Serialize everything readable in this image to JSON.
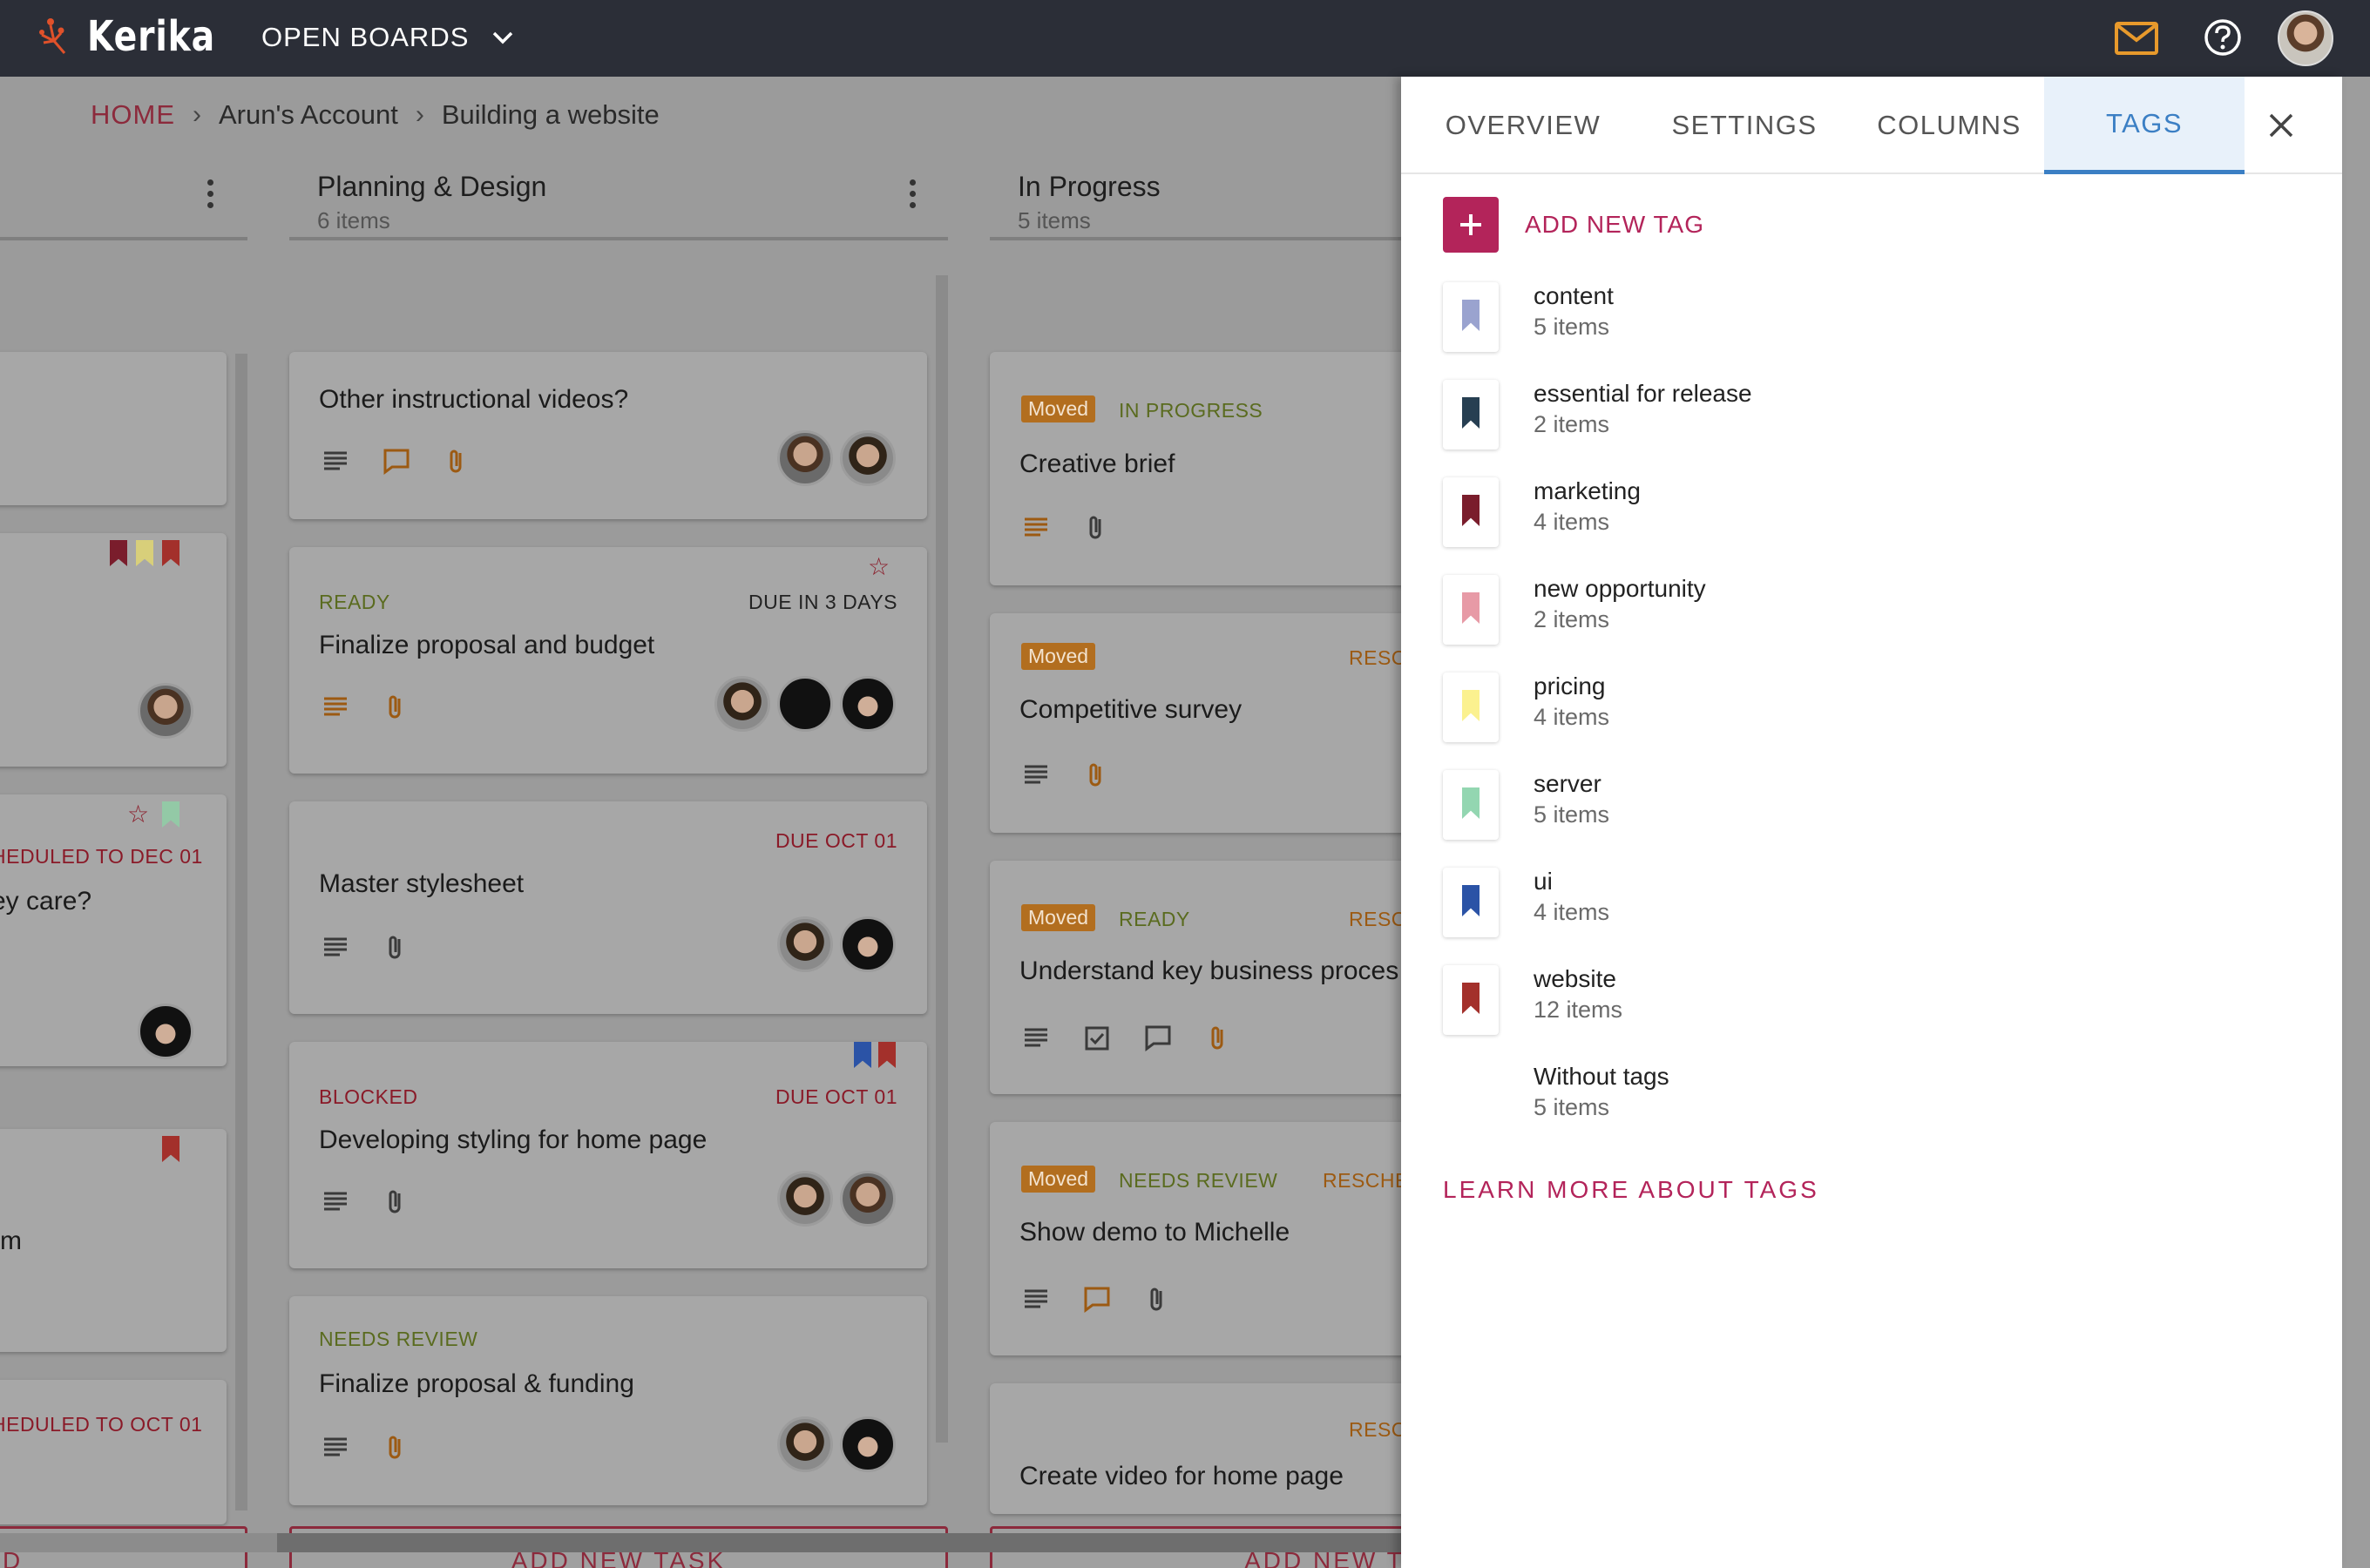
{
  "app": {
    "name": "Kerika",
    "open_boards_label": "OPEN BOARDS",
    "colors": {
      "topbar": "#2b2e37",
      "accent": "#b3245a",
      "tab_active": "#3b7fc4",
      "mail_icon": "#e89a2c"
    }
  },
  "breadcrumb": {
    "home": "HOME",
    "account": "Arun's Account",
    "board": "Building a website"
  },
  "columns": [
    {
      "title": "",
      "count": ""
    },
    {
      "title": "Planning & Design",
      "count": "6 items"
    },
    {
      "title": "In Progress",
      "count": "5 items"
    }
  ],
  "partial_column": {
    "cards": [
      {
        "status": "",
        "title": ""
      },
      {
        "status": "",
        "title": ""
      },
      {
        "status": "HEDULED TO DEC 01",
        "title": "ey care?"
      },
      {
        "status": "",
        "title": "rm"
      },
      {
        "status": "HEDULED TO OCT 01",
        "title": ""
      }
    ],
    "add_label": "D"
  },
  "planning_cards": [
    {
      "status_left": "",
      "status_right": "",
      "title": "Other instructional videos?"
    },
    {
      "status_left": "READY",
      "status_right": "DUE IN 3 DAYS",
      "title": "Finalize proposal and budget"
    },
    {
      "status_left": "",
      "status_right": "DUE OCT 01",
      "title": "Master stylesheet"
    },
    {
      "status_left": "BLOCKED",
      "status_right": "DUE OCT 01",
      "title": "Developing styling for home page"
    },
    {
      "status_left": "NEEDS REVIEW",
      "status_right": "",
      "title": "Finalize proposal & funding"
    }
  ],
  "planning_add_label": "ADD NEW TASK",
  "progress_cards": [
    {
      "moved": "Moved",
      "status": "IN PROGRESS",
      "right": "",
      "title": "Creative brief"
    },
    {
      "moved": "Moved",
      "status": "",
      "right": "RESC",
      "title": "Competitive survey"
    },
    {
      "moved": "Moved",
      "status": "READY",
      "right": "RESC",
      "title": "Understand key business proces"
    },
    {
      "moved": "Moved",
      "status": "NEEDS REVIEW",
      "right": "RESCHE",
      "title": "Show demo to Michelle"
    },
    {
      "moved": "",
      "status": "",
      "right": "RESC",
      "title": "Create video for home page"
    }
  ],
  "progress_add_label": "ADD NEW TAS",
  "panel": {
    "tabs": [
      "OVERVIEW",
      "SETTINGS",
      "COLUMNS",
      "TAGS"
    ],
    "active_tab": "TAGS",
    "add_tag_label": "ADD NEW TAG",
    "tags": [
      {
        "name": "content",
        "count": "5 items",
        "color": "#9aa3cf"
      },
      {
        "name": "essential for release",
        "count": "2 items",
        "color": "#273f52"
      },
      {
        "name": "marketing",
        "count": "4 items",
        "color": "#7a1d2c"
      },
      {
        "name": "new opportunity",
        "count": "2 items",
        "color": "#e79aa6"
      },
      {
        "name": "pricing",
        "count": "4 items",
        "color": "#fbf18f"
      },
      {
        "name": "server",
        "count": "5 items",
        "color": "#93d6b1"
      },
      {
        "name": "ui",
        "count": "4 items",
        "color": "#2b53a6"
      },
      {
        "name": "website",
        "count": "12 items",
        "color": "#a3302b"
      },
      {
        "name": "Without tags",
        "count": "5 items",
        "color": ""
      }
    ],
    "learn_more": "LEARN MORE ABOUT TAGS"
  }
}
